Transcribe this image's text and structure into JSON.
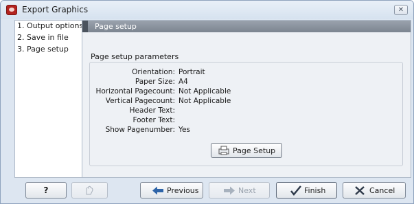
{
  "window": {
    "title": "Export Graphics",
    "close_label": "✕"
  },
  "steps": [
    {
      "label": "1. Output options"
    },
    {
      "label": "2. Save in file"
    },
    {
      "label": "3. Page setup"
    }
  ],
  "content": {
    "section_title": "Page setup",
    "params_title": "Page setup parameters",
    "params": [
      {
        "label": "Orientation:",
        "value": "Portrait"
      },
      {
        "label": "Paper Size:",
        "value": "A4"
      },
      {
        "label": "Horizontal Pagecount:",
        "value": "Not Applicable"
      },
      {
        "label": "Vertical Pagecount:",
        "value": "Not Applicable"
      },
      {
        "label": "Header Text:",
        "value": ""
      },
      {
        "label": "Footer Text:",
        "value": ""
      },
      {
        "label": "Show Pagenumber:",
        "value": "Yes"
      }
    ],
    "page_setup_button": "Page Setup"
  },
  "footer": {
    "help_label": "?",
    "previous_label": "Previous",
    "next_label": "Next",
    "finish_label": "Finish",
    "cancel_label": "Cancel"
  },
  "colors": {
    "accent_arrow": "#2e64a8",
    "finish_check": "#2f3a4a",
    "cancel_x": "#2f3a4a"
  }
}
